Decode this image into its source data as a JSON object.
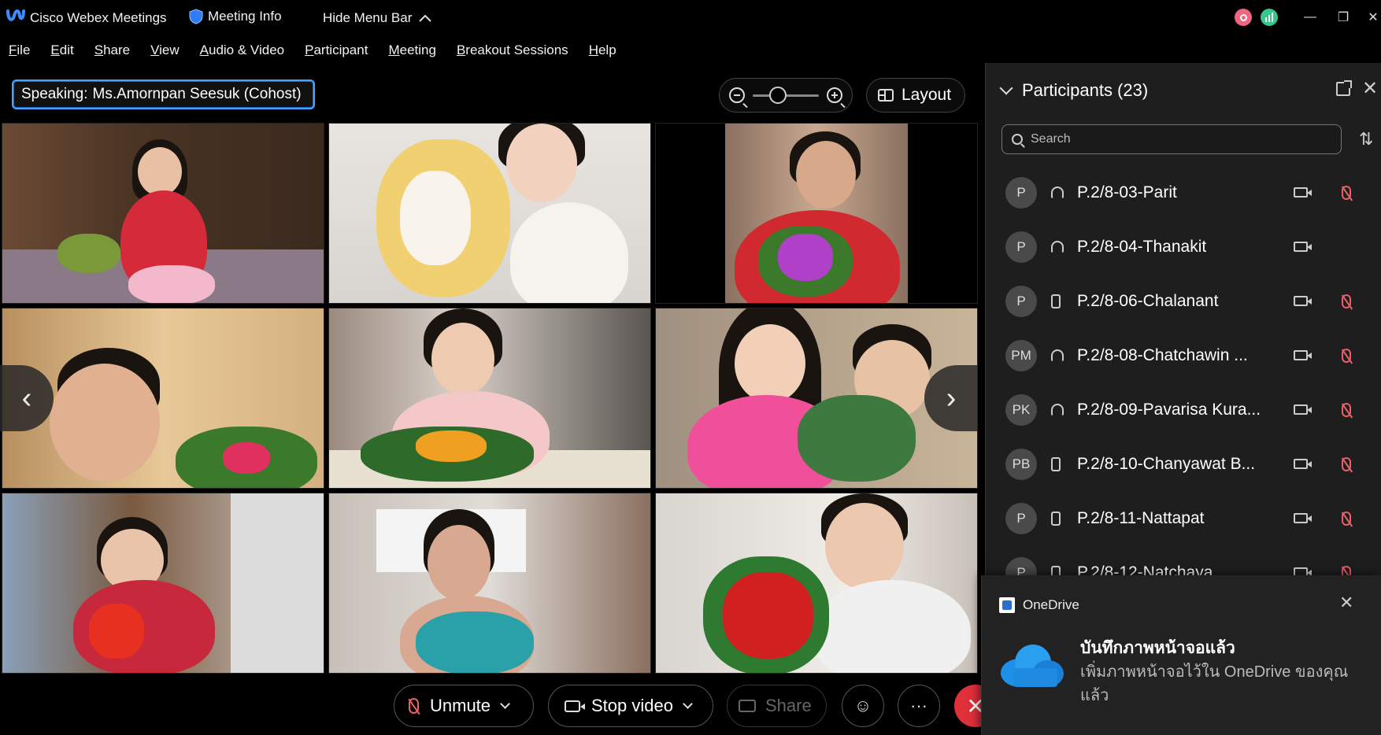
{
  "titlebar": {
    "app_name": "Cisco Webex Meetings",
    "meeting_info": "Meeting Info",
    "hide_menu": "Hide Menu Bar",
    "minimize": "—",
    "restore": "❐",
    "close": "✕"
  },
  "menu": [
    "File",
    "Edit",
    "Share",
    "View",
    "Audio & Video",
    "Participant",
    "Meeting",
    "Breakout Sessions",
    "Help"
  ],
  "stage": {
    "speaking_label": "Speaking:",
    "speaking_name": "Ms.Amornpan Seesuk (Cohost)",
    "zoom_level": 0.25,
    "layout_label": "Layout",
    "prev_arrow": "‹",
    "next_arrow": "›"
  },
  "participants": {
    "header": "Participants (23)",
    "close": "✕",
    "search_placeholder": "Search",
    "sort_icon": "⇅",
    "list": [
      {
        "initials": "P",
        "device": "headset",
        "name": "P.2/8-03-Parit",
        "muted": true
      },
      {
        "initials": "P",
        "device": "headset",
        "name": "P.2/8-04-Thanakit",
        "muted": false
      },
      {
        "initials": "P",
        "device": "phone",
        "name": "P.2/8-06-Chalanant",
        "muted": true
      },
      {
        "initials": "PM",
        "device": "headset",
        "name": "P.2/8-08-Chatchawin ...",
        "muted": true
      },
      {
        "initials": "PK",
        "device": "headset",
        "name": "P.2/8-09-Pavarisa Kura...",
        "muted": true
      },
      {
        "initials": "PB",
        "device": "phone",
        "name": "P.2/8-10-Chanyawat B...",
        "muted": true
      },
      {
        "initials": "P",
        "device": "phone",
        "name": "P.2/8-11-Nattapat",
        "muted": true
      },
      {
        "initials": "P",
        "device": "phone",
        "name": "P.2/8-12-Natchaya",
        "muted": true
      }
    ]
  },
  "controls": {
    "unmute": "Unmute",
    "stop_video": "Stop video",
    "share": "Share",
    "reactions": "☺",
    "more": "···",
    "leave": "✕"
  },
  "toast": {
    "app": "OneDrive",
    "close": "✕",
    "title": "บันทึกภาพหน้าจอแล้ว",
    "body": "เพิ่มภาพหน้าจอไว้ใน OneDrive ของคุณแล้ว"
  },
  "colors": {
    "accent_blue": "#4aa3ff",
    "mute_red": "#e8606a",
    "leave_red": "#e0303a",
    "panel_bg": "#1e1e1e"
  }
}
